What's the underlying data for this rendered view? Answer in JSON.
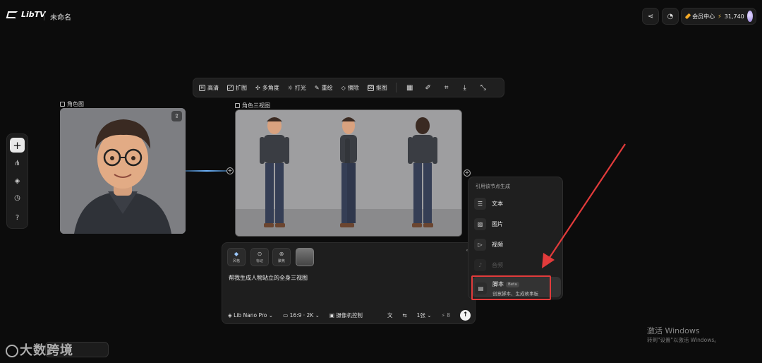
{
  "app": {
    "logo_text": "LibTV",
    "doc_title": "未命名"
  },
  "header": {
    "member_label": "会员中心",
    "credits": "31,740",
    "share_icon": "share-icon",
    "bell_icon": "bell-icon"
  },
  "toolbar": {
    "items": [
      {
        "label": "高清",
        "icon": "hd-icon"
      },
      {
        "label": "扩图",
        "icon": "expand-icon"
      },
      {
        "label": "多角度",
        "icon": "multi-angle-icon"
      },
      {
        "label": "打光",
        "icon": "lighting-icon"
      },
      {
        "label": "重绘",
        "icon": "repaint-icon"
      },
      {
        "label": "擦除",
        "icon": "eraser-icon"
      },
      {
        "label": "抠图",
        "icon": "cutout-icon"
      }
    ]
  },
  "nodes": {
    "character": {
      "label": "角色图"
    },
    "turnaround": {
      "label": "角色三视图"
    }
  },
  "prompt": {
    "chips": [
      "风格",
      "标记",
      "聚焦"
    ],
    "text": "帮我生成人物站立的全身三视图",
    "model": "Lib Nano Pro",
    "ratio": "16:9 · 2K",
    "camera": "摄像机控制",
    "count": "1张",
    "cost": "8"
  },
  "menu": {
    "title": "引用该节点生成",
    "items": [
      {
        "label": "文本",
        "icon": "text-icon"
      },
      {
        "label": "图片",
        "icon": "image-icon"
      },
      {
        "label": "视频",
        "icon": "video-icon"
      },
      {
        "label": "音频",
        "icon": "audio-icon"
      }
    ],
    "script": {
      "label": "脚本",
      "badge": "Beta",
      "sub": "创意脚本、生成故事板"
    }
  },
  "watermark": {
    "win_title": "激活 Windows",
    "win_sub": "转到\"设置\"以激活 Windows。",
    "brand": "大数跨境"
  },
  "colors": {
    "highlight": "#e23b3b",
    "wire": "#6fb6ff",
    "bg": "#0c0c0c"
  }
}
